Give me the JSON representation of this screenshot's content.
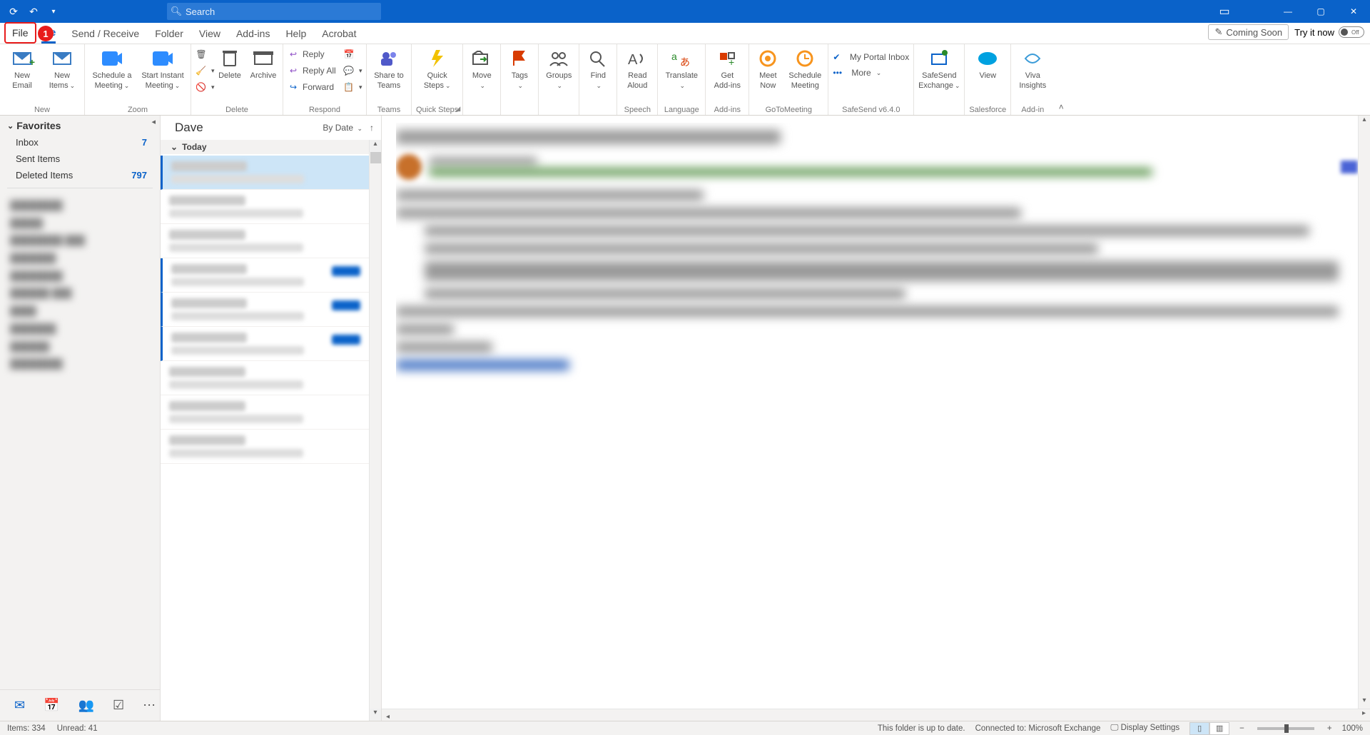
{
  "titlebar": {
    "search_placeholder": "Search"
  },
  "menutabs": {
    "file": "File",
    "badge": "1",
    "home": "me",
    "send_receive": "Send / Receive",
    "folder": "Folder",
    "view": "View",
    "addins": "Add-ins",
    "help": "Help",
    "acrobat": "Acrobat",
    "coming_soon": "Coming Soon",
    "try_it_now": "Try it now",
    "toggle_off": "Off"
  },
  "ribbon": {
    "new": {
      "new_email": "New\nEmail",
      "new_items": "New\nItems",
      "label": "New"
    },
    "zoom": {
      "schedule": "Schedule a\nMeeting",
      "start": "Start Instant\nMeeting",
      "label": "Zoom"
    },
    "delete": {
      "delete": "Delete",
      "archive": "Archive",
      "label": "Delete"
    },
    "respond": {
      "reply": "Reply",
      "reply_all": "Reply All",
      "forward": "Forward",
      "label": "Respond"
    },
    "teams": {
      "share": "Share to\nTeams",
      "label": "Teams"
    },
    "quick": {
      "steps": "Quick\nSteps",
      "label": "Quick Steps"
    },
    "move": {
      "move": "Move",
      "label": ""
    },
    "tags": {
      "tags": "Tags",
      "label": ""
    },
    "groups": {
      "groups": "Groups",
      "label": ""
    },
    "find": {
      "find": "Find",
      "label": ""
    },
    "speech": {
      "read_aloud": "Read\nAloud",
      "label": "Speech"
    },
    "language": {
      "translate": "Translate",
      "label": "Language"
    },
    "addins": {
      "get": "Get\nAdd-ins",
      "label": "Add-ins"
    },
    "goto": {
      "meet_now": "Meet\nNow",
      "schedule": "Schedule\nMeeting",
      "label": "GoToMeeting"
    },
    "safesend": {
      "portal": "My Portal Inbox",
      "more": "More",
      "exchange": "SafeSend\nExchange",
      "label": "SafeSend v6.4.0"
    },
    "salesforce": {
      "view": "View",
      "label": "Salesforce"
    },
    "vivaaddin": {
      "viva": "Viva\nInsights",
      "label": "Add-in"
    }
  },
  "nav": {
    "favorites": "Favorites",
    "items": [
      {
        "label": "Inbox",
        "count": "7"
      },
      {
        "label": "Sent Items",
        "count": ""
      },
      {
        "label": "Deleted Items",
        "count": "797"
      }
    ]
  },
  "msglist": {
    "folder": "Dave",
    "sort": "By Date",
    "today": "Today"
  },
  "status": {
    "items": "Items: 334",
    "unread": "Unread: 41",
    "sync": "This folder is up to date.",
    "connected": "Connected to: Microsoft Exchange",
    "display": "Display Settings",
    "zoom": "100%"
  }
}
